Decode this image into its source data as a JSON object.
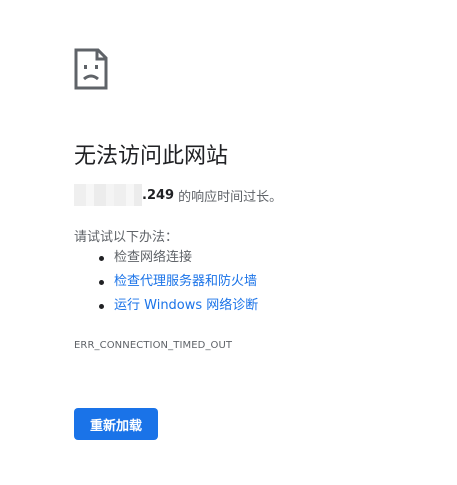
{
  "icon": "sad-page-icon",
  "title": "无法访问此网站",
  "detail": {
    "host_suffix": ".249",
    "message": "的响应时间过长。"
  },
  "try_label": "请试试以下办法：",
  "suggestions": [
    {
      "label": "检查网络连接",
      "link": false
    },
    {
      "label": "检查代理服务器和防火墙",
      "link": true
    },
    {
      "label": "运行 Windows 网络诊断",
      "link": true
    }
  ],
  "error_code": "ERR_CONNECTION_TIMED_OUT",
  "reload_label": "重新加载",
  "colors": {
    "accent": "#1a73e8",
    "text": "#202124",
    "secondary_text": "#5f6368"
  }
}
